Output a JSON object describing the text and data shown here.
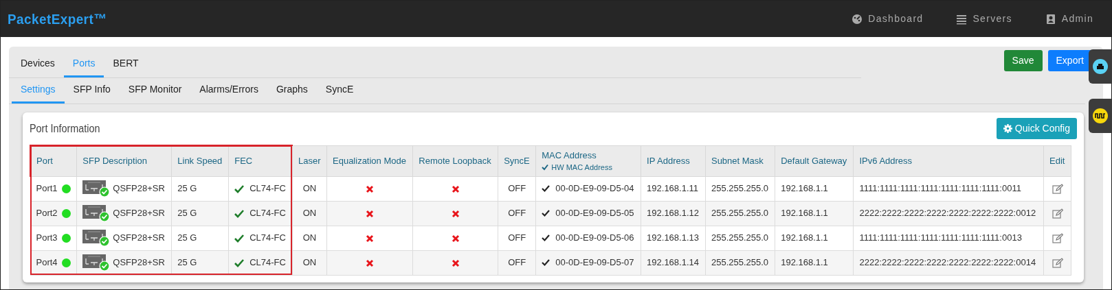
{
  "brand": "PacketExpert™",
  "nav": [
    {
      "label": "Dashboard",
      "kind": "gauge"
    },
    {
      "label": "Servers",
      "kind": "list"
    },
    {
      "label": "Admin",
      "kind": "person"
    }
  ],
  "tabs": [
    {
      "label": "Devices",
      "selected": false
    },
    {
      "label": "Ports",
      "selected": true
    },
    {
      "label": "BERT",
      "selected": false
    }
  ],
  "subtabs": [
    {
      "label": "Settings",
      "selected": true
    },
    {
      "label": "SFP Info",
      "selected": false
    },
    {
      "label": "SFP Monitor",
      "selected": false
    },
    {
      "label": "Alarms/Errors",
      "selected": false
    },
    {
      "label": "Graphs",
      "selected": false
    },
    {
      "label": "SyncE",
      "selected": false
    }
  ],
  "actions": [
    {
      "label": "Save",
      "kind": "success"
    },
    {
      "label": "Export",
      "kind": "primary"
    }
  ],
  "side_tabs": [
    {
      "kind": "ethernet",
      "color": "#5ad2f4"
    },
    {
      "kind": "wave",
      "color": "#f7d70c"
    }
  ],
  "card": {
    "title": "Port Information",
    "quick_config": "Quick Config"
  },
  "table": {
    "columns": [
      {
        "label": "Port",
        "highlighted": true
      },
      {
        "label": "SFP Description",
        "highlighted": true
      },
      {
        "label": "Link Speed",
        "highlighted": true
      },
      {
        "label": "FEC",
        "highlighted": true
      },
      {
        "label": "Laser",
        "highlighted": false
      },
      {
        "label": "Equalization Mode",
        "highlighted": false
      },
      {
        "label": "Remote Loopback",
        "highlighted": false
      },
      {
        "label": "SyncE",
        "highlighted": false
      },
      {
        "label": "MAC Address",
        "highlighted": false,
        "sub": {
          "label": "HW MAC Address",
          "checked": true
        }
      },
      {
        "label": "IP Address",
        "highlighted": false
      },
      {
        "label": "Subnet Mask",
        "highlighted": false
      },
      {
        "label": "Default Gateway",
        "highlighted": false
      },
      {
        "label": "IPv6 Address",
        "highlighted": false
      },
      {
        "label": "Edit",
        "highlighted": false
      }
    ],
    "rows": [
      {
        "port": "Port1",
        "link_up": true,
        "sfp": "QSFP28+SR",
        "sfp_ok": true,
        "speed": "25 G",
        "fec_ok": true,
        "fec": "CL74-FC",
        "laser": "ON",
        "equalization": false,
        "remote_loopback": false,
        "synce": "OFF",
        "mac_hw": true,
        "mac": "00-0D-E9-09-D5-04",
        "ip": "192.168.1.11",
        "mask": "255.255.255.0",
        "gateway": "192.168.1.1",
        "ipv6": "1111:1111:1111:1111:1111:1111:1111:0011"
      },
      {
        "port": "Port2",
        "link_up": true,
        "sfp": "QSFP28+SR",
        "sfp_ok": true,
        "speed": "25 G",
        "fec_ok": true,
        "fec": "CL74-FC",
        "laser": "ON",
        "equalization": false,
        "remote_loopback": false,
        "synce": "OFF",
        "mac_hw": true,
        "mac": "00-0D-E9-09-D5-05",
        "ip": "192.168.1.12",
        "mask": "255.255.255.0",
        "gateway": "192.168.1.1",
        "ipv6": "2222:2222:2222:2222:2222:2222:2222:0012"
      },
      {
        "port": "Port3",
        "link_up": true,
        "sfp": "QSFP28+SR",
        "sfp_ok": true,
        "speed": "25 G",
        "fec_ok": true,
        "fec": "CL74-FC",
        "laser": "ON",
        "equalization": false,
        "remote_loopback": false,
        "synce": "OFF",
        "mac_hw": true,
        "mac": "00-0D-E9-09-D5-06",
        "ip": "192.168.1.13",
        "mask": "255.255.255.0",
        "gateway": "192.168.1.1",
        "ipv6": "1111:1111:1111:1111:1111:1111:1111:0013"
      },
      {
        "port": "Port4",
        "link_up": true,
        "sfp": "QSFP28+SR",
        "sfp_ok": true,
        "speed": "25 G",
        "fec_ok": true,
        "fec": "CL74-FC",
        "laser": "ON",
        "equalization": false,
        "remote_loopback": false,
        "synce": "OFF",
        "mac_hw": true,
        "mac": "00-0D-E9-09-D5-07",
        "ip": "192.168.1.14",
        "mask": "255.255.255.0",
        "gateway": "192.168.1.1",
        "ipv6": "2222:2222:2222:2222:2222:2222:2222:0014"
      }
    ]
  }
}
